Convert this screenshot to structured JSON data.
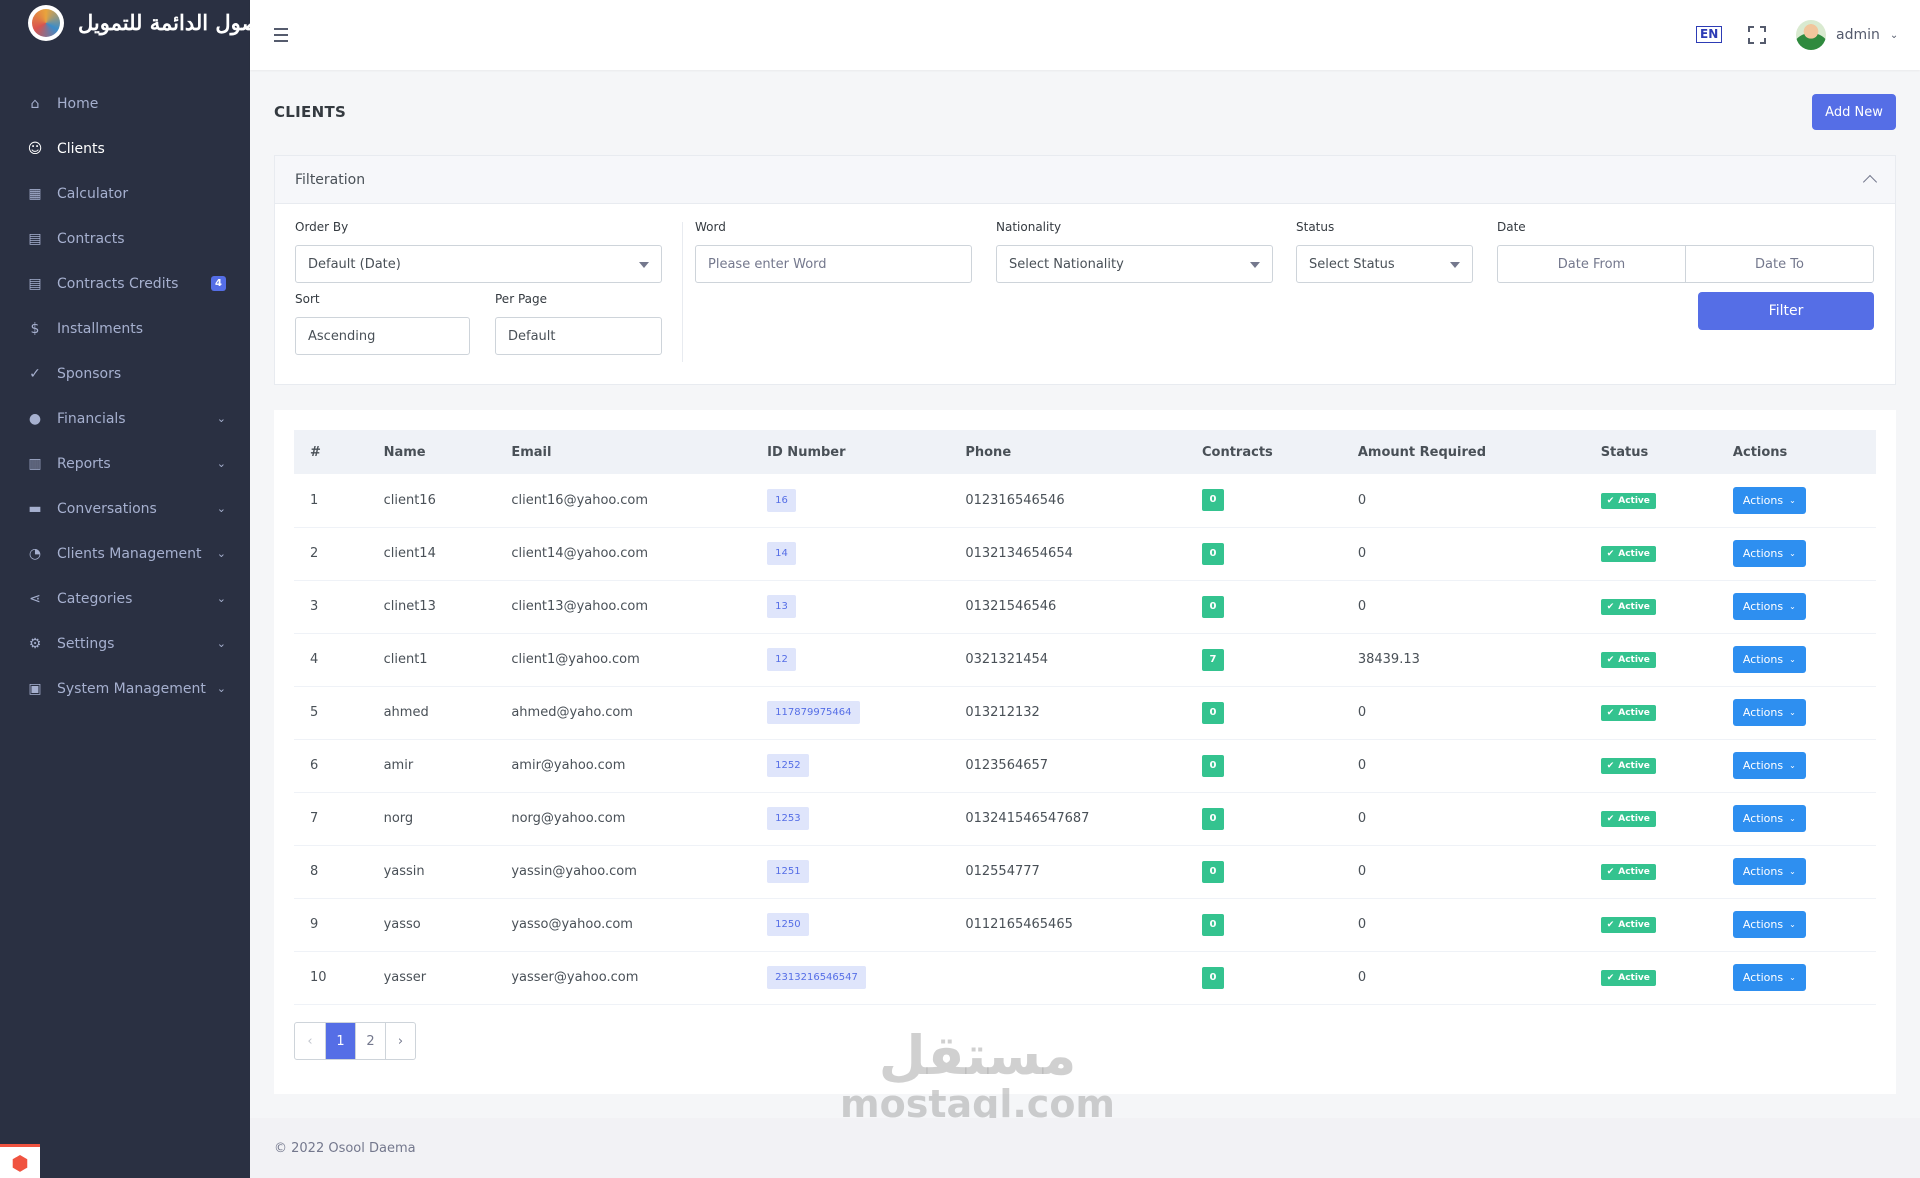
{
  "brand": {
    "name": "الاصول الدائمة للتمويل"
  },
  "sidebar": {
    "items": [
      {
        "label": "Home",
        "icon": "home-icon"
      },
      {
        "label": "Clients",
        "icon": "user-icon",
        "active": true
      },
      {
        "label": "Calculator",
        "icon": "calculator-icon"
      },
      {
        "label": "Contracts",
        "icon": "document-icon"
      },
      {
        "label": "Contracts Credits",
        "icon": "document-icon",
        "badge": "4"
      },
      {
        "label": "Installments",
        "icon": "dollar-icon"
      },
      {
        "label": "Sponsors",
        "icon": "user-check-icon"
      },
      {
        "label": "Financials",
        "icon": "coin-icon",
        "expandable": true
      },
      {
        "label": "Reports",
        "icon": "report-icon",
        "expandable": true
      },
      {
        "label": "Conversations",
        "icon": "chat-icon",
        "expandable": true
      },
      {
        "label": "Clients Management",
        "icon": "user-voice-icon",
        "expandable": true
      },
      {
        "label": "Categories",
        "icon": "share-icon",
        "expandable": true
      },
      {
        "label": "Settings",
        "icon": "gear-icon",
        "expandable": true
      },
      {
        "label": "System Management",
        "icon": "id-card-icon",
        "expandable": true
      }
    ]
  },
  "topbar": {
    "language": "EN",
    "username": "admin"
  },
  "page": {
    "title": "CLIENTS",
    "add_new": "Add New"
  },
  "filter": {
    "title": "Filteration",
    "order_by": {
      "label": "Order By",
      "value": "Default (Date)"
    },
    "word": {
      "label": "Word",
      "placeholder": "Please enter Word"
    },
    "nationality": {
      "label": "Nationality",
      "value": "Select Nationality"
    },
    "status": {
      "label": "Status",
      "value": "Select Status"
    },
    "date": {
      "label": "Date",
      "from": "Date From",
      "to": "Date To"
    },
    "sort": {
      "label": "Sort",
      "value": "Ascending"
    },
    "per_page": {
      "label": "Per Page",
      "value": "Default"
    },
    "button": "Filter"
  },
  "table": {
    "columns": [
      "#",
      "Name",
      "Email",
      "ID Number",
      "Phone",
      "Contracts",
      "Amount Required",
      "Status",
      "Actions"
    ],
    "rows": [
      {
        "n": "1",
        "name": "client16",
        "email": "client16@yahoo.com",
        "id": "16",
        "phone": "012316546546",
        "contracts": "0",
        "amount": "0",
        "status": "Active",
        "action": "Actions"
      },
      {
        "n": "2",
        "name": "client14",
        "email": "client14@yahoo.com",
        "id": "14",
        "phone": "0132134654654",
        "contracts": "0",
        "amount": "0",
        "status": "Active",
        "action": "Actions"
      },
      {
        "n": "3",
        "name": "clinet13",
        "email": "client13@yahoo.com",
        "id": "13",
        "phone": "01321546546",
        "contracts": "0",
        "amount": "0",
        "status": "Active",
        "action": "Actions"
      },
      {
        "n": "4",
        "name": "client1",
        "email": "client1@yahoo.com",
        "id": "12",
        "phone": "0321321454",
        "contracts": "7",
        "amount": "38439.13",
        "status": "Active",
        "action": "Actions"
      },
      {
        "n": "5",
        "name": "ahmed",
        "email": "ahmed@yaho.com",
        "id": "117879975464",
        "phone": "013212132",
        "contracts": "0",
        "amount": "0",
        "status": "Active",
        "action": "Actions"
      },
      {
        "n": "6",
        "name": "amir",
        "email": "amir@yahoo.com",
        "id": "1252",
        "phone": "0123564657",
        "contracts": "0",
        "amount": "0",
        "status": "Active",
        "action": "Actions"
      },
      {
        "n": "7",
        "name": "norg",
        "email": "norg@yahoo.com",
        "id": "1253",
        "phone": "013241546547687",
        "contracts": "0",
        "amount": "0",
        "status": "Active",
        "action": "Actions"
      },
      {
        "n": "8",
        "name": "yassin",
        "email": "yassin@yahoo.com",
        "id": "1251",
        "phone": "012554777",
        "contracts": "0",
        "amount": "0",
        "status": "Active",
        "action": "Actions"
      },
      {
        "n": "9",
        "name": "yasso",
        "email": "yasso@yahoo.com",
        "id": "1250",
        "phone": "0112165465465",
        "contracts": "0",
        "amount": "0",
        "status": "Active",
        "action": "Actions"
      },
      {
        "n": "10",
        "name": "yasser",
        "email": "yasser@yahoo.com",
        "id": "2313216546547",
        "phone": "",
        "contracts": "0",
        "amount": "0",
        "status": "Active",
        "action": "Actions"
      }
    ]
  },
  "pagination": {
    "prev": "‹",
    "pages": [
      "1",
      "2"
    ],
    "current": "1",
    "next": "›"
  },
  "watermark": {
    "arabic": "مستقل",
    "latin": "mostaql.com"
  },
  "footer": {
    "text": "© 2022 Osool Daema"
  },
  "colors": {
    "sidebar": "#2a3042",
    "primary": "#556ee6",
    "success": "#34c38f",
    "info": "#2e8ff0"
  }
}
